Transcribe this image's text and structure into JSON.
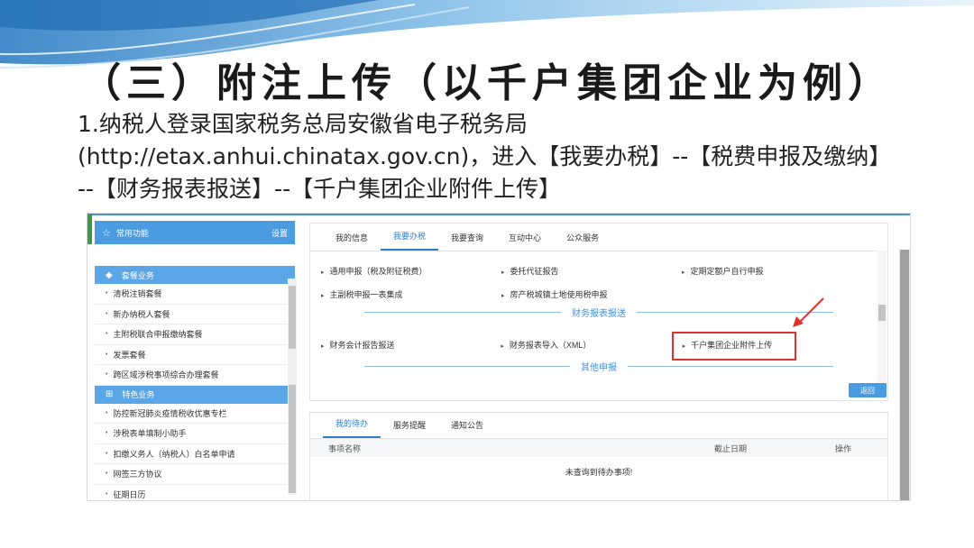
{
  "slide": {
    "title": "（三）附注上传（以千户集团企业为例）",
    "lines": [
      "1.纳税人登录国家税务总局安徽省电子税务局",
      "(http://etax.anhui.chinatax.gov.cn)，进入【我要办税】--【税费申报及缴纳】",
      "--【财务报表报送】--【千户集团企业附件上传】"
    ]
  },
  "sidebar": {
    "header_label": "常用功能",
    "settings_label": "设置",
    "section1_label": "套餐业务",
    "section1_items": [
      "清税注销套餐",
      "新办纳税人套餐",
      "主附税联合申报缴纳套餐",
      "发票套餐",
      "跨区域涉税事项综合办理套餐"
    ],
    "section2_label": "特色业务",
    "section2_items": [
      "防控新冠肺炎疫情税收优惠专栏",
      "涉税表单填制小助手",
      "扣缴义务人（纳税人）白名单申请",
      "网签三方协议",
      "征期日历"
    ]
  },
  "tabs": [
    "我的信息",
    "我要办税",
    "我要查询",
    "互动中心",
    "公众服务"
  ],
  "active_tab": "我要办税",
  "menu": {
    "row1": [
      "通用申报（税及附征税费）",
      "委托代征报告",
      "定期定额户自行申报"
    ],
    "row2": [
      "主副税申报一表集成",
      "房产税城镇土地使用税申报"
    ],
    "section_financial": "财务报表报送",
    "row3": [
      "财务会计报告报送",
      "财务报表导入（XML）",
      "千户集团企业附件上传"
    ],
    "section_other": "其他申报"
  },
  "return_label": "返回",
  "todo": {
    "tabs": [
      "我的待办",
      "服务提醒",
      "通知公告"
    ],
    "columns": [
      "事项名称",
      "截止日期",
      "操作"
    ],
    "empty_text": "未查询到待办事项!"
  },
  "colors": {
    "accent": "#4b9be0",
    "highlight": "#e03030"
  }
}
